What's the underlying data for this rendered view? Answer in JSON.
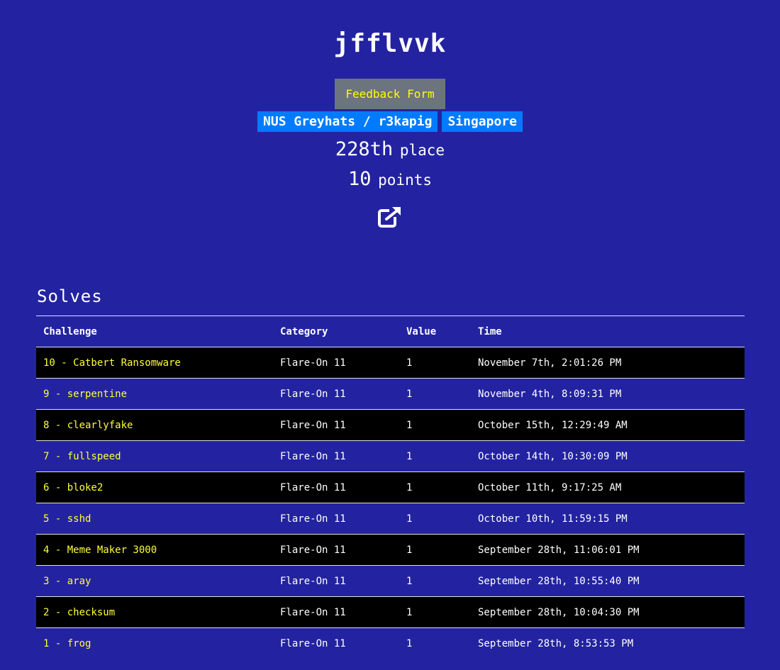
{
  "user": {
    "name": "jfflvvk",
    "feedback_label": "Feedback Form",
    "team_badge": "NUS Greyhats / r3kapig",
    "country_badge": "Singapore",
    "place_value": "228th",
    "place_unit": "place",
    "points_value": "10",
    "points_unit": "points",
    "external_link_icon": "external-link-icon"
  },
  "solves": {
    "title": "Solves",
    "headers": [
      "Challenge",
      "Category",
      "Value",
      "Time"
    ],
    "rows": [
      {
        "challenge": "10 - Catbert Ransomware",
        "category": "Flare-On 11",
        "value": "1",
        "time": "November 7th, 2:01:26 PM"
      },
      {
        "challenge": "9 - serpentine",
        "category": "Flare-On 11",
        "value": "1",
        "time": "November 4th, 8:09:31 PM"
      },
      {
        "challenge": "8 - clearlyfake",
        "category": "Flare-On 11",
        "value": "1",
        "time": "October 15th, 12:29:49 AM"
      },
      {
        "challenge": "7 - fullspeed",
        "category": "Flare-On 11",
        "value": "1",
        "time": "October 14th, 10:30:09 PM"
      },
      {
        "challenge": "6 - bloke2",
        "category": "Flare-On 11",
        "value": "1",
        "time": "October 11th, 9:17:25 AM"
      },
      {
        "challenge": "5 - sshd",
        "category": "Flare-On 11",
        "value": "1",
        "time": "October 10th, 11:59:15 PM"
      },
      {
        "challenge": "4 - Meme Maker 3000",
        "category": "Flare-On 11",
        "value": "1",
        "time": "September 28th, 11:06:01 PM"
      },
      {
        "challenge": "3 - aray",
        "category": "Flare-On 11",
        "value": "1",
        "time": "September 28th, 10:55:40 PM"
      },
      {
        "challenge": "2 - checksum",
        "category": "Flare-On 11",
        "value": "1",
        "time": "September 28th, 10:04:30 PM"
      },
      {
        "challenge": "1 - frog",
        "category": "Flare-On 11",
        "value": "1",
        "time": "September 28th, 8:53:53 PM"
      }
    ]
  },
  "colors": {
    "background": "#2323a1",
    "challenge_link": "#ffff33",
    "badge": "#007bff",
    "feedback_button": "#6c757d",
    "feedback_text": "#ffff00",
    "striped_row": "#000000"
  }
}
